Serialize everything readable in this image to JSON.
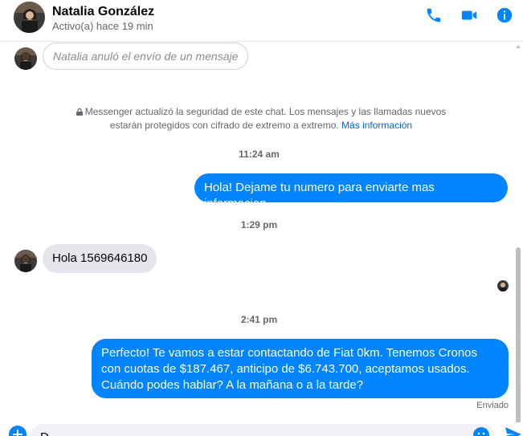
{
  "header": {
    "name": "Natalia González",
    "status": "Activo(a) hace 19 min"
  },
  "messages": {
    "unsent_notice": "Natalia anuló el envío de un mensaje",
    "security_notice": "Messenger actualizó la seguridad de este chat. Los mensajes y las llamadas nuevos estarán protegidos con cifrado de extremo a extremo.",
    "security_link": "Más información",
    "time_1": "11:24 am",
    "out_1": "Hola! Dejame tu numero para enviarte mas informacion",
    "time_2": "1:29 pm",
    "in_1": "Hola 1569646180",
    "time_3": "2:41 pm",
    "out_2": "Perfecto! Te vamos a estar contactando de Fiat 0km. Tenemos Cronos con cuotas de $187.467, anticipo de $6.743.700, aceptamos usados. Cuándo podes hablar? A la mañana o a la tarde?",
    "sent_status": "Enviado"
  },
  "composer": {
    "draft": "D"
  },
  "colors": {
    "accent": "#0084ff",
    "incoming_bubble": "#e4e6eb",
    "muted_text": "#65676b"
  },
  "icons": [
    "phone-icon",
    "video-icon",
    "info-icon",
    "lock-icon",
    "plus-icon",
    "emoji-icon",
    "send-icon"
  ]
}
